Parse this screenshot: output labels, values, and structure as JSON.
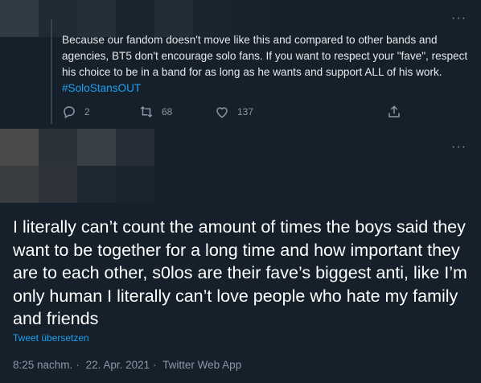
{
  "reply_tweet": {
    "text": "Because our fandom doesn't move like this and compared to other bands and agencies, BT5 don't encourage solo fans. If you want to respect your \"fave\", respect his choice to be in a band for as long as he wants and support ALL of his work.",
    "hashtag": "#SoloStansOUT",
    "reply_count": "2",
    "retweet_count": "68",
    "like_count": "137",
    "more_label": "···"
  },
  "main_tweet": {
    "text": "I literally can’t count the amount of times the boys said they want to be together for a long time and how important they are to each other, s0los are their fave’s biggest anti, like I’m only human I literally can’t love people who hate my family and friends",
    "translate_label": "Tweet übersetzen",
    "time": "8:25 nachm.",
    "date": "22. Apr. 2021",
    "source": "Twitter Web App",
    "separator": "·",
    "more_label": "···"
  },
  "colors": {
    "background": "#15202b",
    "accent": "#1da1f2",
    "muted": "#8899a6",
    "text": "#e7e9ea"
  }
}
